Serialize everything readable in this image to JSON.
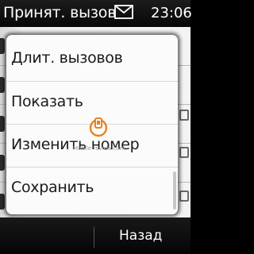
{
  "status_bar": {
    "title": "Принят. вызов",
    "icon": "envelope-icon",
    "time": "23:06"
  },
  "menu": {
    "items": [
      {
        "label": "Длит. вызовов"
      },
      {
        "label": "Показать"
      },
      {
        "label": "Изменить номер"
      },
      {
        "label": "Сохранить"
      }
    ]
  },
  "softkeys": {
    "right_label": "Назад"
  },
  "watermark": {
    "text": "Mobile-review.com"
  },
  "colors": {
    "status_bar_bg": "#111111",
    "menu_bg": "#fbfbfb",
    "menu_text": "#1a1a1a",
    "watermark_accent": "#e8821e"
  }
}
